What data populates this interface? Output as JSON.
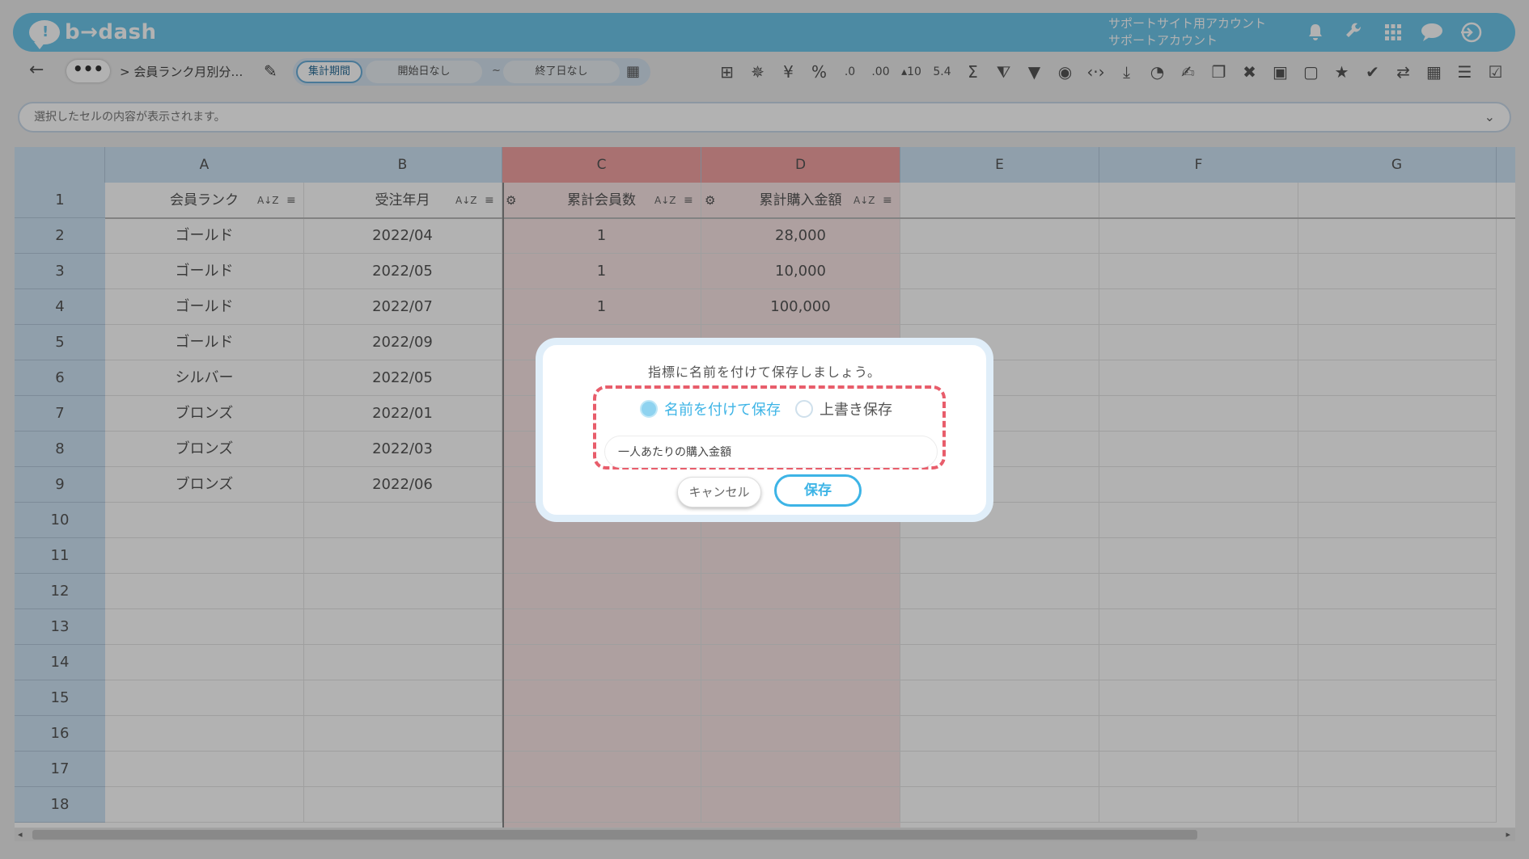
{
  "header": {
    "logo_text": "b→dash",
    "account_line1": "サポートサイト用アカウント",
    "account_line2": "サポートアカウント",
    "icons": [
      "bell-icon",
      "wrench-icon",
      "apps-grid-icon",
      "chat-icon",
      "logout-icon"
    ],
    "bg_color": "#6ec6ea"
  },
  "toolbar": {
    "back_glyph": "←",
    "more_glyph": "•••",
    "breadcrumb": "> 会員ランク月別分…",
    "pencil_glyph": "✎",
    "period_label": "集計期間",
    "start_label": "開始日なし",
    "tilde": "~",
    "end_label": "終了日なし",
    "calendar_glyph": "▦",
    "tool_glyphs": [
      "⊞",
      "✵",
      "¥",
      "%",
      ".0",
      ".00",
      "▴10",
      "5.4",
      "Σ",
      "⧨",
      "▼",
      "◉",
      "‹·›",
      "⤓",
      "◔",
      "✍",
      "❐",
      "✖",
      "▣",
      "▢",
      "★",
      "✔",
      "⇄",
      "▦",
      "☰",
      "☑"
    ]
  },
  "formula_bar": {
    "placeholder": "選択したセルの内容が表示されます。",
    "chevron": "⌄"
  },
  "grid": {
    "columns": [
      "A",
      "B",
      "C",
      "D",
      "E",
      "F",
      "G"
    ],
    "headers": [
      "会員ランク",
      "受注年月",
      "累計会員数",
      "累計購入金額"
    ],
    "sort_glyph": "A↓Z",
    "filter_glyph": "≡",
    "gear_glyph": "⚙",
    "row_numbers": [
      "1",
      "2",
      "3",
      "4",
      "5",
      "6",
      "7",
      "8",
      "9",
      "10",
      "11",
      "12",
      "13",
      "14",
      "15",
      "16",
      "17",
      "18"
    ],
    "rows": [
      [
        "ゴールド",
        "2022/04",
        "1",
        "28,000"
      ],
      [
        "ゴールド",
        "2022/05",
        "1",
        "10,000"
      ],
      [
        "ゴールド",
        "2022/07",
        "1",
        "100,000"
      ],
      [
        "ゴールド",
        "2022/09",
        "",
        ""
      ],
      [
        "シルバー",
        "2022/05",
        "",
        ""
      ],
      [
        "ブロンズ",
        "2022/01",
        "",
        ""
      ],
      [
        "ブロンズ",
        "2022/03",
        "",
        ""
      ],
      [
        "ブロンズ",
        "2022/06",
        "",
        ""
      ]
    ],
    "selected_columns": [
      "C",
      "D"
    ],
    "selected_color": "#f3a3a3"
  },
  "dialog": {
    "title": "指標に名前を付けて保存しましょう。",
    "radio_save_as": "名前を付けて保存",
    "radio_overwrite": "上書き保存",
    "selected_radio": "名前を付けて保存",
    "name_value": "一人あたりの購入金額",
    "cancel_label": "キャンセル",
    "save_label": "保存",
    "highlight_color": "#e85d6b",
    "accent_color": "#3db4e6"
  },
  "scrollbar": {
    "left_arrow": "◂",
    "right_arrow": "▸"
  }
}
